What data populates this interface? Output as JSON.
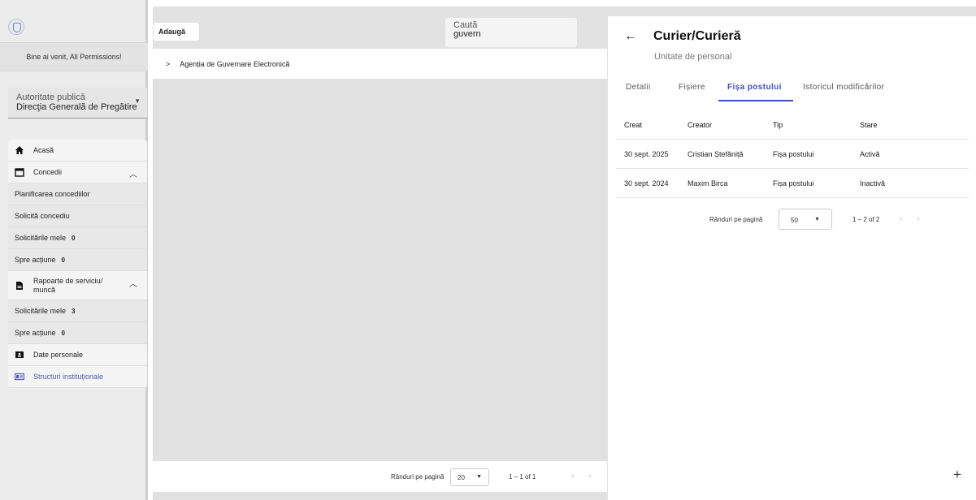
{
  "sidebar": {
    "welcome": "Bine ai venit, All Permissions!",
    "authority_label": "Autoritate publică",
    "authority_value": "Direcţia Generală de Pregătire",
    "menu": {
      "home": "Acasă",
      "leave": "Concedii",
      "leave_items": [
        "Planificarea concediilor",
        "Solicită concediu",
        "Solicitările mele",
        "Spre acțiune"
      ],
      "leave_counts": [
        "0",
        "0"
      ],
      "reports": "Rapoarte de serviciu/ muncă",
      "reports_items": [
        "Solicitările mele",
        "Spre acțiune"
      ],
      "reports_counts": [
        "3",
        "0"
      ],
      "personal": "Date personale",
      "structures": "Structuri instituționale"
    }
  },
  "middle": {
    "add_label": "Adaugă",
    "search_label": "Caută",
    "search_value": "guvern",
    "tree_row": "Agenția de Guvernare Electronică",
    "footer": {
      "rows_per_page": "Rânduri pe pagină",
      "page_size": "20",
      "range": "1 – 1 of 1"
    }
  },
  "detail": {
    "title": "Curier/Curieră",
    "subtitle": "Unitate de personal",
    "tabs": [
      "Detalii",
      "Fișiere",
      "Fișa postului",
      "Istoricul modificărilor"
    ],
    "active_tab": "Fișa postului",
    "columns": [
      "Creat",
      "Creator",
      "Tip",
      "Stare"
    ],
    "rows": [
      [
        "30 sept. 2025",
        "Cristian Ștefăniță",
        "Fișa postului",
        "Activă"
      ],
      [
        "30 sept. 2024",
        "Maxim Birca",
        "Fișa postului",
        "Inactivă"
      ]
    ],
    "pager": {
      "rows_per_page": "Rânduri pe pagină",
      "page_size": "50",
      "range": "1 – 2 of 2"
    },
    "fab": "+"
  },
  "colors": {
    "accent": "#3f51b5",
    "sidebar_bg": "#ececec",
    "panel_bg": "#e1e1e1"
  },
  "icons": [
    "logo-icon",
    "home-icon",
    "calendar-icon",
    "document-icon",
    "id-card-icon",
    "badge-icon",
    "chevron-up-icon",
    "chevron-right-icon",
    "arrow-left-icon",
    "chevron-down-icon",
    "chevron-left-icon",
    "plus-icon"
  ]
}
